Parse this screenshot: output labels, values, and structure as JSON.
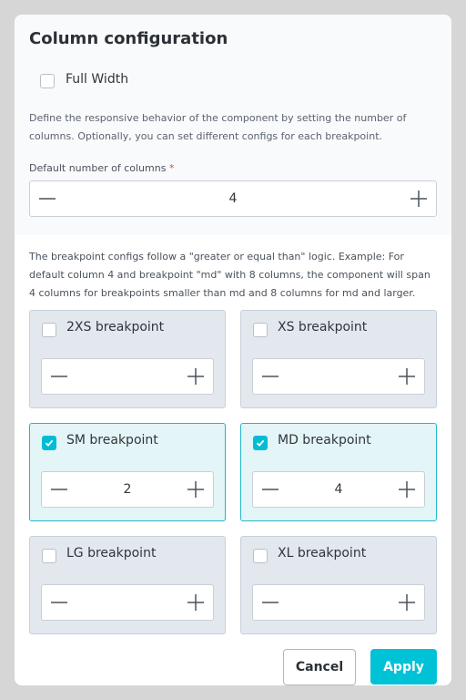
{
  "dialog": {
    "title": "Column configuration",
    "full_width_label": "Full Width",
    "full_width_checked": false,
    "description": "Define the responsive behavior of the component by setting the number of columns. Optionally, you can set different configs for each breakpoint.",
    "default_columns_label": "Default number of columns",
    "required_marker": "*",
    "default_columns_value": "4",
    "breakpoint_note": "The breakpoint configs follow a \"greater or equal than\" logic. Example: For default column 4 and breakpoint \"md\" with 8 columns, the component will span 4 columns for breakpoints smaller than md and 8 columns for md and larger."
  },
  "breakpoints": [
    {
      "label": "2XS breakpoint",
      "checked": false,
      "value": ""
    },
    {
      "label": "XS breakpoint",
      "checked": false,
      "value": ""
    },
    {
      "label": "SM breakpoint",
      "checked": true,
      "value": "2"
    },
    {
      "label": "MD breakpoint",
      "checked": true,
      "value": "4"
    },
    {
      "label": "LG breakpoint",
      "checked": false,
      "value": ""
    },
    {
      "label": "XL breakpoint",
      "checked": false,
      "value": ""
    }
  ],
  "actions": {
    "cancel_label": "Cancel",
    "apply_label": "Apply"
  },
  "icons": {
    "minus": "minus-icon",
    "plus": "plus-icon",
    "check": "check-icon"
  },
  "colors": {
    "accent": "#00c2d7",
    "required": "#e04444"
  }
}
